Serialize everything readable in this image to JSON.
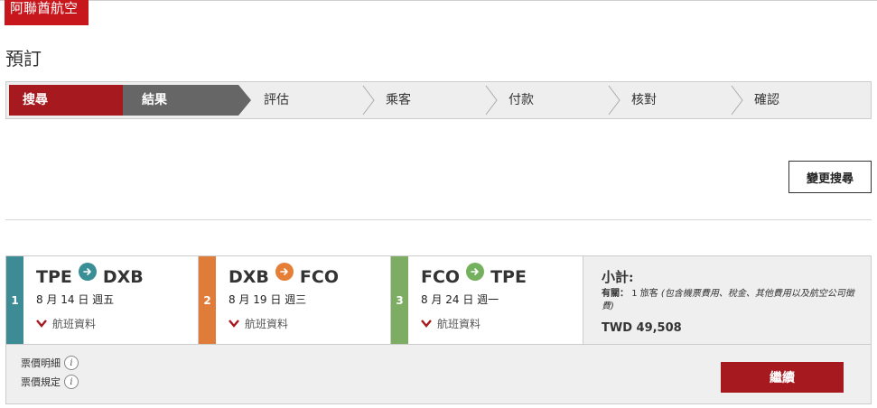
{
  "brand": {
    "logo_text": "阿聯酋航空",
    "color": "#c8161d"
  },
  "page": {
    "title": "預訂"
  },
  "steps": [
    {
      "label": "搜尋",
      "state": "active"
    },
    {
      "label": "結果",
      "state": "done"
    },
    {
      "label": "評估",
      "state": "todo"
    },
    {
      "label": "乘客",
      "state": "todo"
    },
    {
      "label": "付款",
      "state": "todo"
    },
    {
      "label": "核對",
      "state": "todo"
    },
    {
      "label": "確認",
      "state": "todo"
    }
  ],
  "change_search_label": "變更搜尋",
  "legs": [
    {
      "num": "1",
      "from": "TPE",
      "to": "DXB",
      "date": "8 月 14 日 週五",
      "info_label": "航班資料",
      "color": "#3d8b94",
      "arrow_color": "#3a8f96"
    },
    {
      "num": "2",
      "from": "DXB",
      "to": "FCO",
      "date": "8 月 19 日 週三",
      "info_label": "航班資料",
      "color": "#e07c3a",
      "arrow_color": "#e57f37"
    },
    {
      "num": "3",
      "from": "FCO",
      "to": "TPE",
      "date": "8 月 24 日 週一",
      "info_label": "航班資料",
      "color": "#7cad62",
      "arrow_color": "#74b05d"
    }
  ],
  "subtotal": {
    "title": "小計:",
    "note_label": "有關：",
    "note_text": "1 旅客",
    "note_italic": "(包含機票費用、稅金、其他費用以及航空公司徵費)",
    "price": "TWD 49,508"
  },
  "fare_links": [
    "票價明細",
    "票價規定"
  ],
  "continue_label": "繼續",
  "icons": {
    "arrow": "arrow-right-icon",
    "chevron": "chevron-down-icon",
    "info": "info-icon"
  }
}
